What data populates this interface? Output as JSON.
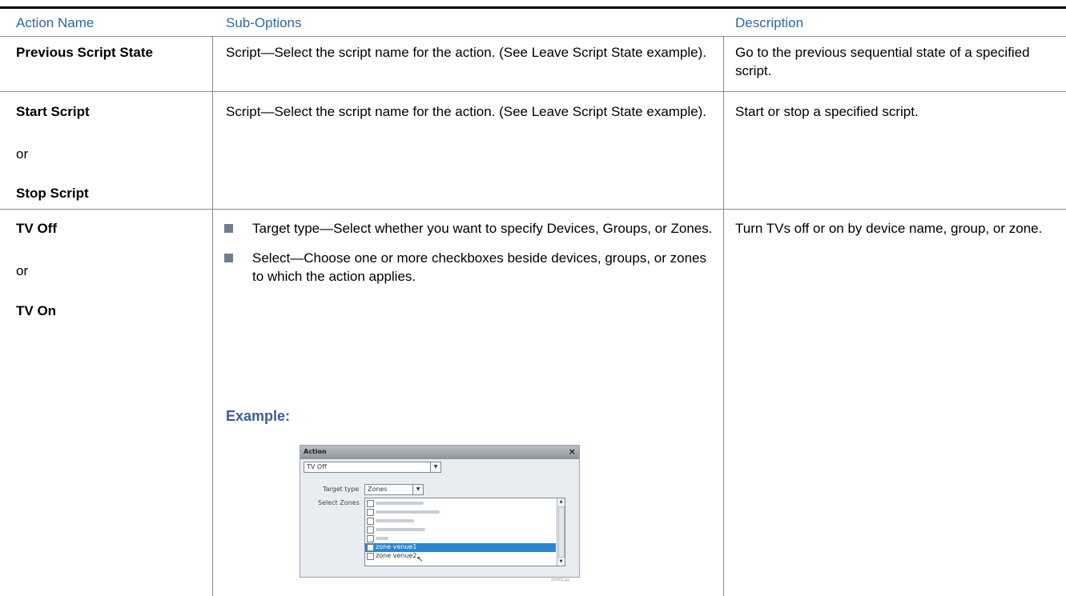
{
  "header": {
    "col1": "Action Name",
    "col2": "Sub-Options",
    "col3": "Description"
  },
  "rows": [
    {
      "action": "Previous Script State",
      "suboption": "Script—Select the script name for the action. (See Leave Script State example).",
      "description": "Go to the previous sequential state of a specified script."
    },
    {
      "action_a": "Start Script",
      "or": "or",
      "action_b": "Stop Script",
      "suboption": "Script—Select the script name for the action. (See Leave Script State example).",
      "description": "Start or stop a specified script."
    },
    {
      "action_a": "TV Off",
      "or": "or",
      "action_b": "TV On",
      "bullets": [
        "Target type—Select whether you want to specify Devices, Groups, or Zones.",
        "Select—Choose one or more checkboxes beside devices, groups, or zones to which the action applies."
      ],
      "example_label": "Example:",
      "description": "Turn TVs off or on by device name, group, or zone."
    }
  ],
  "dialog": {
    "title": "Action",
    "close": "×",
    "action_value": "TV Off",
    "target_type_label": "Target type",
    "target_type_value": "Zones",
    "select_label": "Select Zones",
    "zones": [
      "zone venue1",
      "zone venue2"
    ],
    "highlighted_zone": "zone venue1",
    "figure_id": "420093.jpg"
  },
  "colors": {
    "header_text": "#2d68a4",
    "example_text": "#3e5c96",
    "bullet": "#6e7d8f",
    "selection": "#2b86d0"
  }
}
